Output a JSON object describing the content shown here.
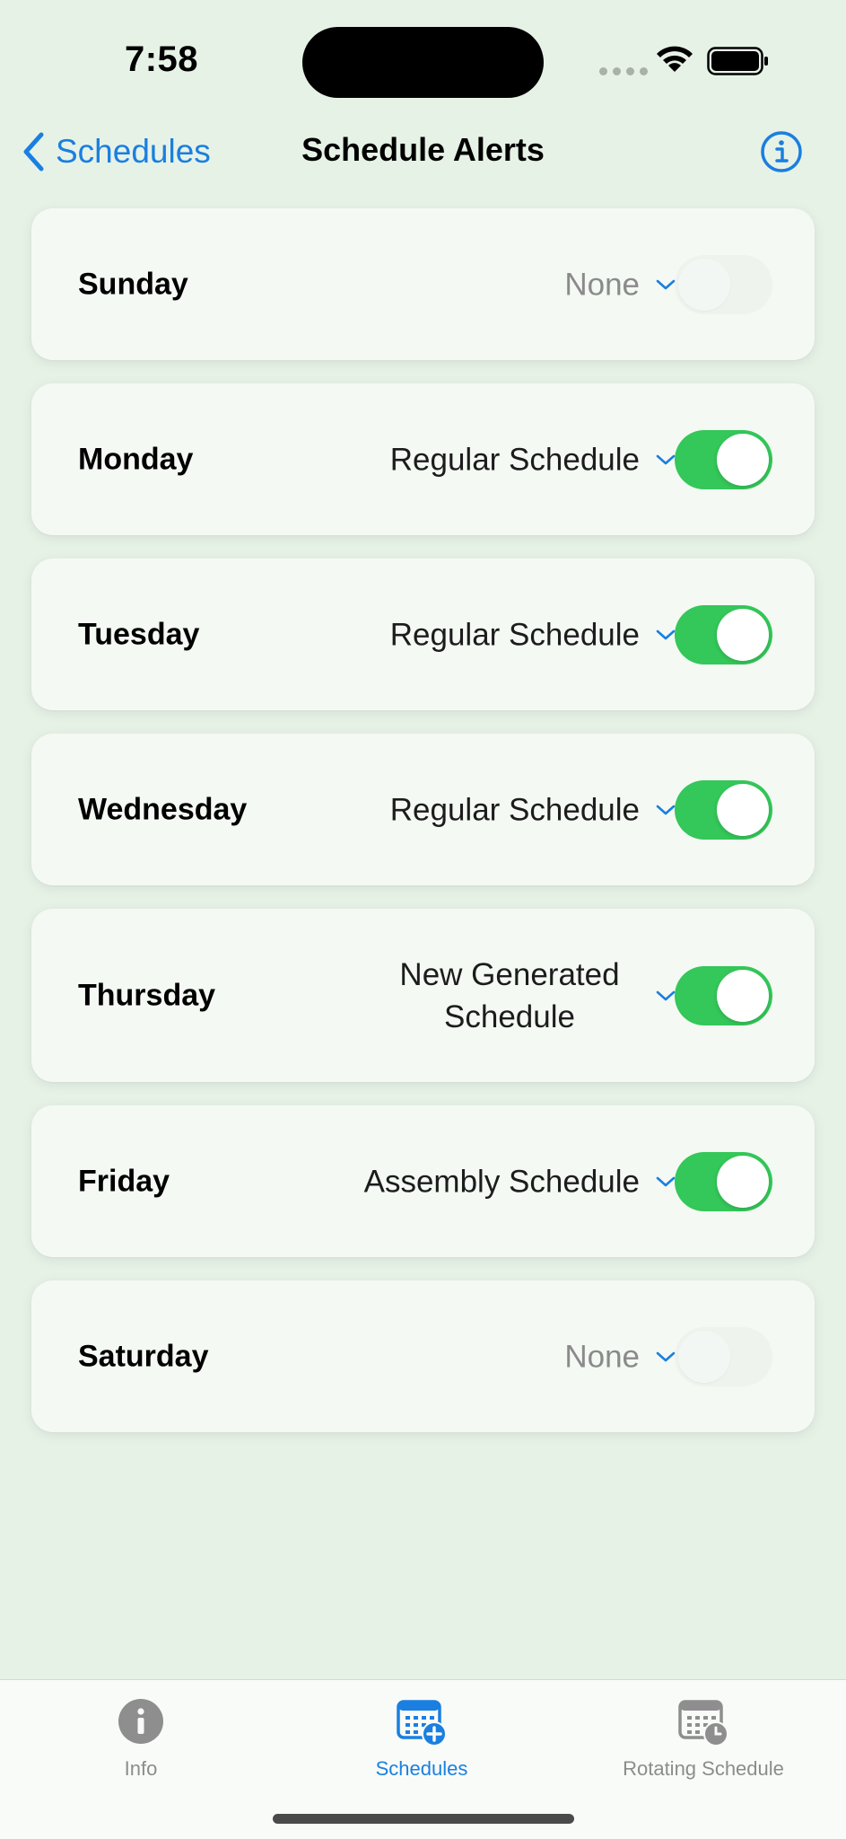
{
  "status_bar": {
    "time": "7:58"
  },
  "nav": {
    "back_label": "Schedules",
    "title": "Schedule Alerts"
  },
  "days": [
    {
      "name": "Sunday",
      "schedule": "None",
      "enabled": false
    },
    {
      "name": "Monday",
      "schedule": "Regular Schedule",
      "enabled": true
    },
    {
      "name": "Tuesday",
      "schedule": "Regular Schedule",
      "enabled": true
    },
    {
      "name": "Wednesday",
      "schedule": "Regular Schedule",
      "enabled": true
    },
    {
      "name": "Thursday",
      "schedule": "New Generated Schedule",
      "enabled": true
    },
    {
      "name": "Friday",
      "schedule": "Assembly Schedule",
      "enabled": true
    },
    {
      "name": "Saturday",
      "schedule": "None",
      "enabled": false
    }
  ],
  "tabs": [
    {
      "label": "Info",
      "icon": "info-circle-icon",
      "active": false
    },
    {
      "label": "Schedules",
      "icon": "calendar-add-icon",
      "active": true
    },
    {
      "label": "Rotating Schedule",
      "icon": "calendar-clock-icon",
      "active": false
    }
  ],
  "colors": {
    "accent": "#1a7fe0",
    "toggle_on": "#34c759",
    "background": "#e7f2e7"
  }
}
